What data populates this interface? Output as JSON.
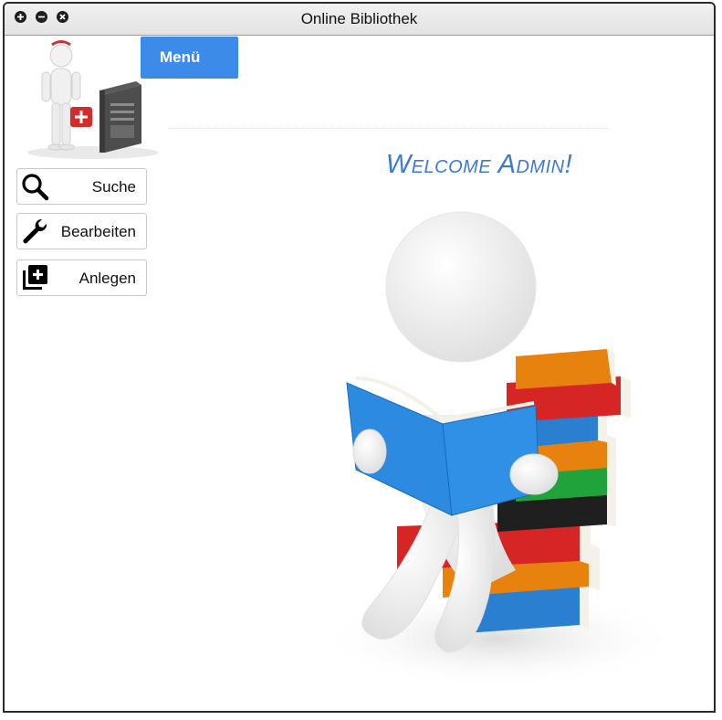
{
  "window": {
    "title": "Online Bibliothek",
    "controls": [
      "maximize-icon",
      "minimize-icon",
      "close-icon"
    ]
  },
  "menu_button": {
    "label": "Menü"
  },
  "sidebar": {
    "items": [
      {
        "label": "Suche",
        "icon": "search-icon"
      },
      {
        "label": "Bearbeiten",
        "icon": "wrench-icon"
      },
      {
        "label": "Anlegen",
        "icon": "add-to-library-icon"
      }
    ]
  },
  "welcome": {
    "text": "Welcome Admin!"
  },
  "colors": {
    "accent": "#3d8be8",
    "welcome_text": "#3b78d8"
  }
}
